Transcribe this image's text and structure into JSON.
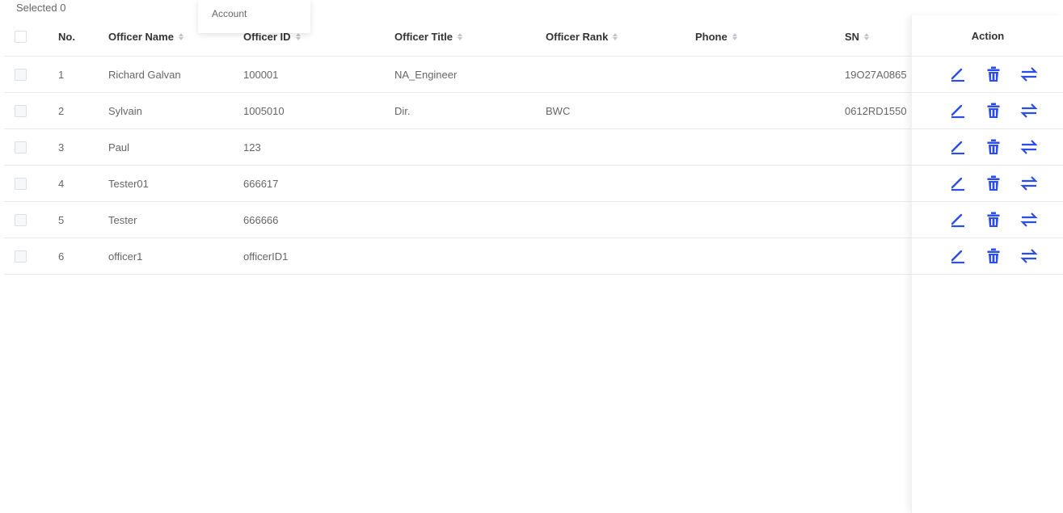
{
  "selection": {
    "label": "Selected 0"
  },
  "menu": {
    "items": [
      "Account"
    ]
  },
  "table": {
    "columns": [
      "No.",
      "Officer Name",
      "Officer ID",
      "Officer Title",
      "Officer Rank",
      "Phone",
      "SN"
    ],
    "action_header": "Action",
    "rows": [
      {
        "no": "1",
        "name": "Richard Galvan",
        "id": "100001",
        "title": "NA_Engineer",
        "rank": "",
        "phone": "",
        "sn": "19O27A0865"
      },
      {
        "no": "2",
        "name": "Sylvain",
        "id": "1005010",
        "title": "Dir.",
        "rank": "BWC",
        "phone": "",
        "sn": "0612RD1550"
      },
      {
        "no": "3",
        "name": "Paul",
        "id": "123",
        "title": "",
        "rank": "",
        "phone": "",
        "sn": ""
      },
      {
        "no": "4",
        "name": "Tester01",
        "id": "666617",
        "title": "",
        "rank": "",
        "phone": "",
        "sn": ""
      },
      {
        "no": "5",
        "name": "Tester",
        "id": "666666",
        "title": "",
        "rank": "",
        "phone": "",
        "sn": ""
      },
      {
        "no": "6",
        "name": "officer1",
        "id": "officerID1",
        "title": "",
        "rank": "",
        "phone": "",
        "sn": ""
      }
    ]
  },
  "icons": [
    "edit-icon",
    "delete-icon",
    "transfer-icon"
  ],
  "colors": {
    "accent": "#2b4eea",
    "border": "#e8eaee",
    "text": "#666666",
    "header_text": "#333333"
  }
}
